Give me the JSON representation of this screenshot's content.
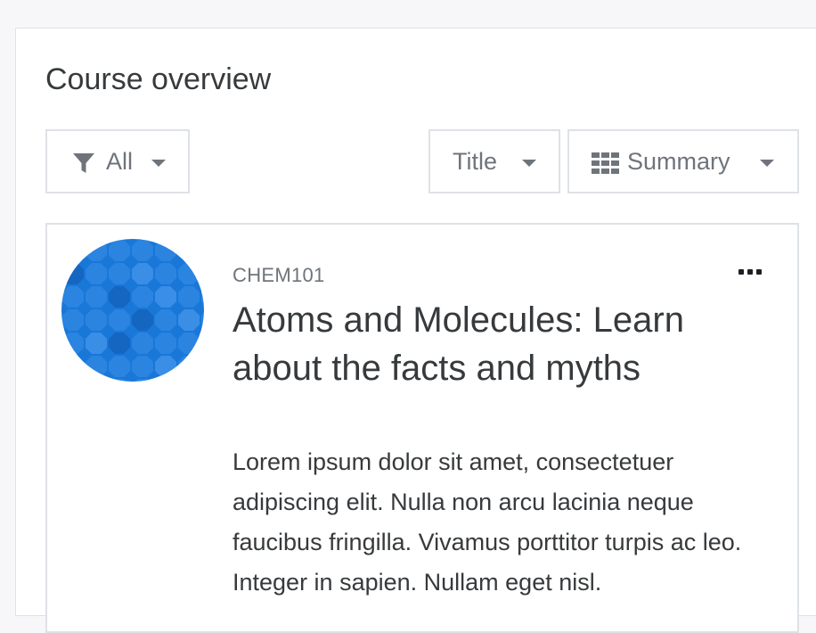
{
  "block": {
    "title": "Course overview"
  },
  "filters": {
    "filter_label": "All",
    "filter_icon": "filter-icon",
    "sort_label": "Title",
    "view_label": "Summary",
    "view_icon": "grid-icon"
  },
  "course": {
    "shortname": "CHEM101",
    "fullname": "Atoms and Molecules: Learn about the facts and myths",
    "summary": "Lorem ipsum dolor sit amet, consectetuer adipiscing elit. Nulla non arcu lacinia neque faucibus fringilla. Vivamus porttitor turpis ac leo. Integer in sapien. Nullam eget nisl.",
    "actions_icon": "ellipsis-icon"
  },
  "colors": {
    "course_image_base": "#1977d8",
    "course_image_dark": "#1566c0",
    "course_image_light": "#3a8ee6"
  }
}
